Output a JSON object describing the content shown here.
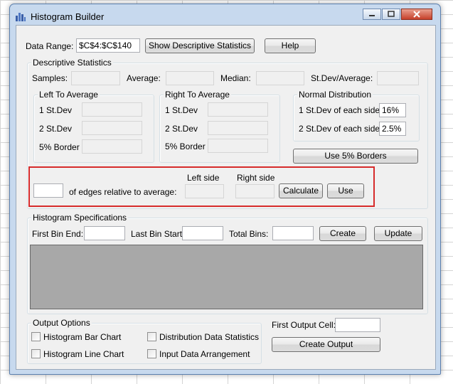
{
  "window": {
    "title": "Histogram Builder"
  },
  "data_range": {
    "label": "Data Range:",
    "value": "$C$4:$C$140",
    "show_stats_button": "Show Descriptive Statistics",
    "help_button": "Help"
  },
  "descriptive": {
    "title": "Descriptive Statistics",
    "samples_label": "Samples:",
    "average_label": "Average:",
    "median_label": "Median:",
    "stdev_avg_label": "St.Dev/Average:",
    "left": {
      "title": "Left To Average",
      "row1": "1 St.Dev",
      "row2": "2 St.Dev",
      "row3": "5% Border"
    },
    "right": {
      "title": "Right To Average",
      "row1": "1 St.Dev",
      "row2": "2 St.Dev",
      "row3": "5% Border"
    },
    "normal": {
      "title": "Normal Distribution",
      "row1_label": "1 St.Dev of each side",
      "row1_value": "16%",
      "row2_label": "2 St.Dev of each side",
      "row2_value": "2.5%",
      "use_borders_button": "Use 5% Borders"
    },
    "edges": {
      "label": "of edges relative to average:",
      "left_side": "Left side",
      "right_side": "Right side",
      "calculate_button": "Calculate",
      "use_button": "Use"
    }
  },
  "histogram": {
    "title": "Histogram Specifications",
    "first_bin_label": "First Bin End:",
    "last_bin_label": "Last Bin Start:",
    "total_bins_label": "Total Bins:",
    "create_button": "Create",
    "update_button": "Update"
  },
  "output": {
    "title": "Output Options",
    "bar_chart": "Histogram Bar Chart",
    "line_chart": "Histogram Line Chart",
    "dist_stats": "Distribution Data Statistics",
    "input_arrangement": "Input Data Arrangement",
    "first_cell_label": "First Output Cell:",
    "create_output_button": "Create Output"
  },
  "colors": {
    "highlight": "#d62b2b",
    "window_frame": "#c7d9ee",
    "dialog_bg": "#f0f0f0"
  }
}
